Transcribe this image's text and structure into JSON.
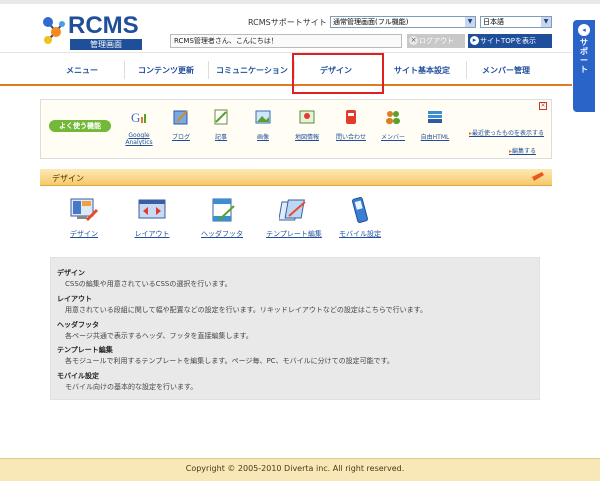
{
  "header": {
    "logo_text": "RCMS",
    "logo_sub": "管理画面",
    "support_label": "RCMSサポートサイト",
    "mode_select": "通常管理画面(フル機能)",
    "lang_select": "日本語",
    "greeting": "RCMS管理者さん、こんにちは！",
    "logout_label": "ログアウト",
    "site_top_label": "サイトTOPを表示"
  },
  "nav": {
    "items": [
      {
        "label": "メニュー"
      },
      {
        "label": "コンテンツ更新"
      },
      {
        "label": "コミュニケーション"
      },
      {
        "label": "デザイン"
      },
      {
        "label": "サイト基本設定"
      },
      {
        "label": "メンバー管理"
      }
    ],
    "active": "デザイン"
  },
  "sidebar": {
    "label": "サポート"
  },
  "quick": {
    "label": "よく使う機能",
    "items": [
      {
        "label": "Google Analytics",
        "icon": "google-analytics-icon"
      },
      {
        "label": "ブログ",
        "icon": "blog-icon"
      },
      {
        "label": "記事",
        "icon": "article-icon"
      },
      {
        "label": "画像",
        "icon": "image-icon"
      },
      {
        "label": "地図情報",
        "icon": "map-icon"
      },
      {
        "label": "問い合わせ",
        "icon": "inquiry-icon"
      },
      {
        "label": "メンバー",
        "icon": "member-icon"
      },
      {
        "label": "自由HTML",
        "icon": "free-html-icon"
      }
    ],
    "recent_link": "最近使ったものを表示する",
    "edit_link": "編集する"
  },
  "section": {
    "title": "デザイン"
  },
  "design_items": [
    {
      "label": "デザイン"
    },
    {
      "label": "レイアウト"
    },
    {
      "label": "ヘッダフッタ"
    },
    {
      "label": "テンプレート編集"
    },
    {
      "label": "モバイル設定"
    }
  ],
  "descriptions": [
    {
      "heading": "デザイン",
      "text": "CSSの編集や用意されているCSSの選択を行います。"
    },
    {
      "heading": "レイアウト",
      "text": "用意されている段組に関して幅や配置などの設定を行います。リキッドレイアウトなどの設定はこちらで行います。"
    },
    {
      "heading": "ヘッダフッタ",
      "text": "各ページ共通で表示するヘッダ、フッタを直接編集します。"
    },
    {
      "heading": "テンプレート編集",
      "text": "各モジュールで利用するテンプレートを編集します。ページ毎、PC、モバイルに分けての設定可能です。"
    },
    {
      "heading": "モバイル設定",
      "text": "モバイル向けの基本的な設定を行います。"
    }
  ],
  "footer": {
    "copyright": "Copyright © 2005-2010 Diverta inc. All right reserved."
  },
  "colors": {
    "brand": "#1f4e9a",
    "accent": "#e07b20",
    "active_outline": "#e02020"
  }
}
